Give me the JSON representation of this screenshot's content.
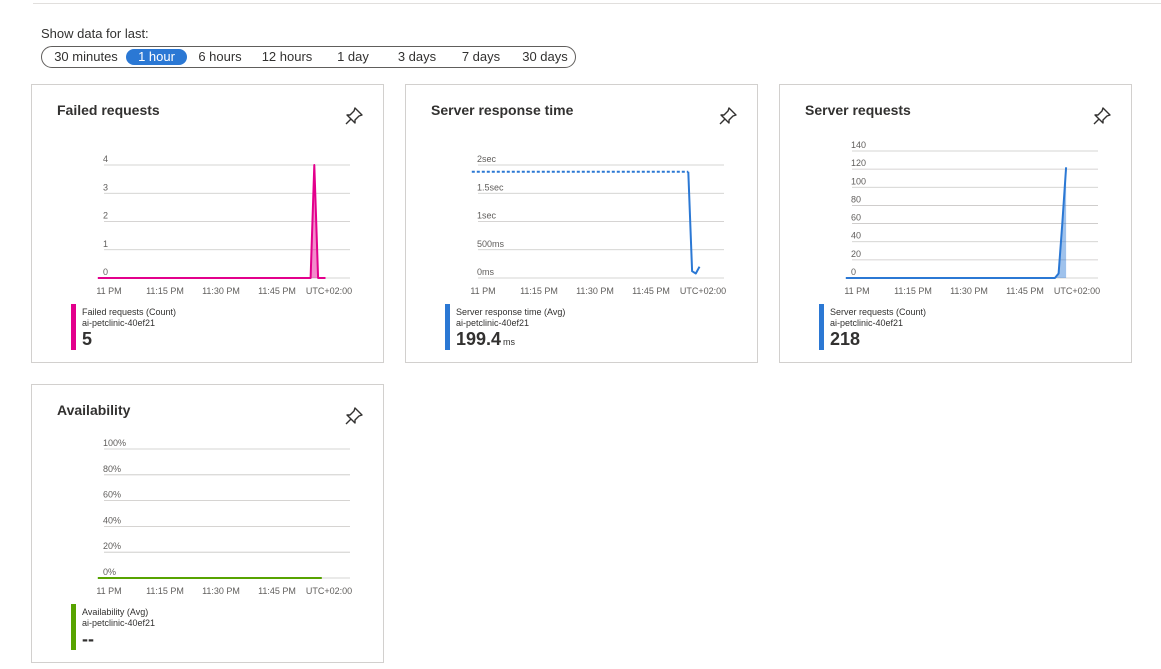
{
  "filter": {
    "label": "Show data for last:",
    "options": [
      "30 minutes",
      "1 hour",
      "6 hours",
      "12 hours",
      "1 day",
      "3 days",
      "7 days",
      "30 days"
    ],
    "selected": "1 hour"
  },
  "tiles": [
    {
      "title": "Failed requests",
      "legend_name": "Failed requests (Count)",
      "resource": "ai-petclinic-40ef21",
      "value": "5",
      "unit": "",
      "color": "#e3008c"
    },
    {
      "title": "Server response time",
      "legend_name": "Server response time (Avg)",
      "resource": "ai-petclinic-40ef21",
      "value": "199.4",
      "unit": "ms",
      "color": "#2b78d4"
    },
    {
      "title": "Server requests",
      "legend_name": "Server requests (Count)",
      "resource": "ai-petclinic-40ef21",
      "value": "218",
      "unit": "",
      "color": "#2b78d4"
    },
    {
      "title": "Availability",
      "legend_name": "Availability (Avg)",
      "resource": "ai-petclinic-40ef21",
      "value": "--",
      "unit": "",
      "color": "#57a300"
    }
  ],
  "chart_data": [
    {
      "type": "area",
      "title": "Failed requests",
      "x_ticks": [
        "11 PM",
        "11:15 PM",
        "11:30 PM",
        "11:45 PM",
        "UTC+02:00"
      ],
      "y_ticks": [
        "0",
        "1",
        "2",
        "3",
        "4"
      ],
      "ylim": [
        0,
        4
      ],
      "series": [
        {
          "name": "Failed requests (Count)",
          "color": "#e3008c",
          "x_minutes": [
            -3,
            54,
            55,
            56,
            58
          ],
          "values": [
            0,
            0,
            4,
            0,
            0
          ]
        }
      ]
    },
    {
      "type": "line",
      "title": "Server response time",
      "x_ticks": [
        "11 PM",
        "11:15 PM",
        "11:30 PM",
        "11:45 PM",
        "UTC+02:00"
      ],
      "y_ticks": [
        "0ms",
        "500ms",
        "1sec",
        "1.5sec",
        "2sec"
      ],
      "ylim": [
        0,
        2000
      ],
      "series": [
        {
          "name": "Server response time (Avg)",
          "style": "dashed",
          "color": "#2b78d4",
          "x_minutes": [
            -3,
            55
          ],
          "values": [
            1880,
            1880
          ]
        },
        {
          "name": "Server response time (Avg)",
          "style": "solid",
          "color": "#2b78d4",
          "x_minutes": [
            55,
            56,
            57,
            58
          ],
          "values": [
            1880,
            120,
            80,
            200
          ]
        }
      ]
    },
    {
      "type": "area",
      "title": "Server requests",
      "x_ticks": [
        "11 PM",
        "11:15 PM",
        "11:30 PM",
        "11:45 PM",
        "UTC+02:00"
      ],
      "y_ticks": [
        "0",
        "20",
        "40",
        "60",
        "80",
        "100",
        "120",
        "140"
      ],
      "ylim": [
        0,
        140
      ],
      "series": [
        {
          "name": "Server requests (Count)",
          "color": "#2b78d4",
          "x_minutes": [
            -3,
            53,
            54,
            55,
            56
          ],
          "values": [
            0,
            0,
            5,
            60,
            122
          ]
        }
      ]
    },
    {
      "type": "line",
      "title": "Availability",
      "x_ticks": [
        "11 PM",
        "11:15 PM",
        "11:30 PM",
        "11:45 PM",
        "UTC+02:00"
      ],
      "y_ticks": [
        "0%",
        "20%",
        "40%",
        "60%",
        "80%",
        "100%"
      ],
      "ylim": [
        0,
        100
      ],
      "series": [
        {
          "name": "Availability (Avg)",
          "color": "#57a300",
          "x_minutes": [
            -3,
            57
          ],
          "values": [
            0,
            0
          ]
        }
      ]
    }
  ],
  "icons": {
    "pin": "pin-icon"
  }
}
